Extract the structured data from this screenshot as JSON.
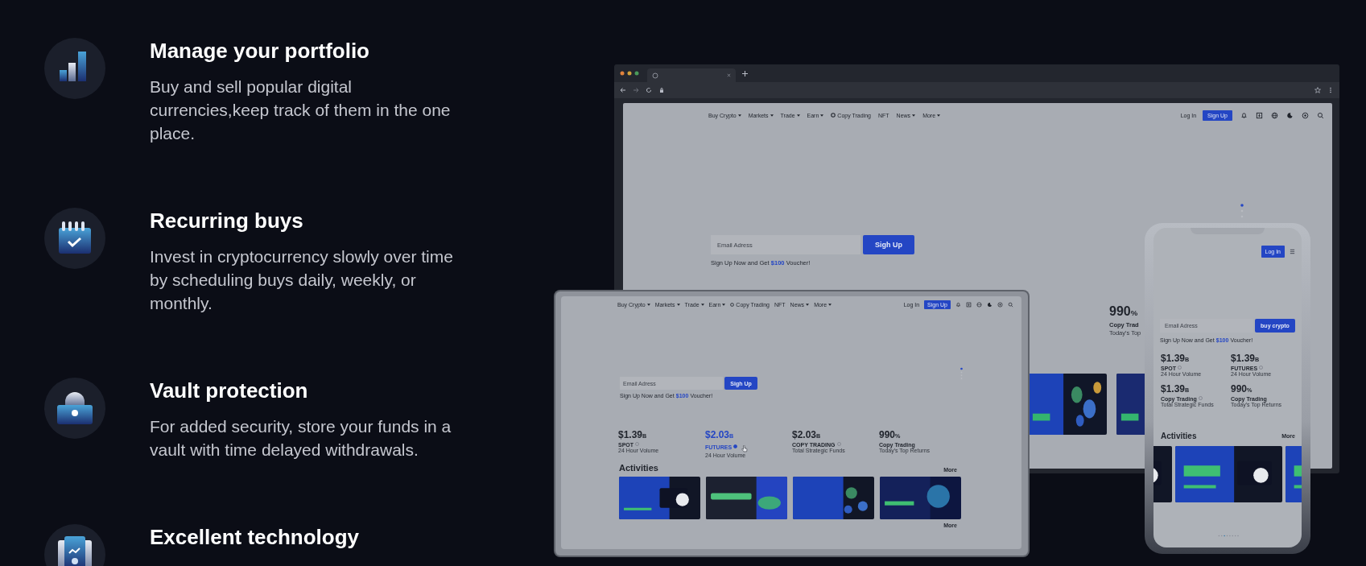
{
  "features": [
    {
      "title": "Manage your portfolio",
      "description": "Buy and sell popular digital currencies,keep track of them in the one place."
    },
    {
      "title": "Recurring buys",
      "description": "Invest in cryptocurrency slowly over time by scheduling buys daily, weekly, or monthly."
    },
    {
      "title": "Vault protection",
      "description": "For added security, store your funds in a vault with time delayed withdrawals."
    },
    {
      "title": "Excellent technology"
    }
  ],
  "browser": {
    "nav": [
      {
        "label": "Buy Crypto",
        "kind": "menu"
      },
      {
        "label": "Markets",
        "kind": "menu"
      },
      {
        "label": "Trade",
        "kind": "menu"
      },
      {
        "label": "Earn",
        "kind": "menu"
      },
      {
        "label": "Copy Trading",
        "kind": "featured"
      },
      {
        "label": "NFT",
        "kind": "link"
      },
      {
        "label": "News",
        "kind": "menu"
      },
      {
        "label": "More",
        "kind": "menu"
      }
    ],
    "login": "Log In",
    "signup": "Sign Up",
    "email_placeholder": "Email Adress",
    "hero_button": "Sigh Up",
    "voucher": {
      "before": "Sign Up Now and Get",
      "amount": "$100",
      "after": "Voucher!"
    },
    "stat": {
      "value": "990",
      "unit": "%",
      "label": "Copy Trad",
      "sub": "Today's Top"
    }
  },
  "laptop": {
    "nav": [
      {
        "label": "Buy Crypto",
        "kind": "menu"
      },
      {
        "label": "Markets",
        "kind": "menu"
      },
      {
        "label": "Trade",
        "kind": "menu"
      },
      {
        "label": "Earn",
        "kind": "menu"
      },
      {
        "label": "Copy Trading",
        "kind": "featured"
      },
      {
        "label": "NFT",
        "kind": "link"
      },
      {
        "label": "News",
        "kind": "menu"
      },
      {
        "label": "More",
        "kind": "menu"
      }
    ],
    "login": "Log In",
    "signup": "Sign Up",
    "email_placeholder": "Email Adress",
    "hero_button": "Sigh Up",
    "voucher": {
      "before": "Sign Up Now and Get",
      "amount": "$100",
      "after": "Voucher!"
    },
    "stats": [
      {
        "value": "$1.39",
        "unit": "B",
        "label": "SPOT",
        "info": true,
        "sub": "24 Hour Volume",
        "highlighted": false
      },
      {
        "value": "$2.03",
        "unit": "B",
        "label": "FUTURES",
        "info": true,
        "sub": "24 Hour Volume",
        "highlighted": true
      },
      {
        "value": "$2.03",
        "unit": "B",
        "label": "COPY TRADING",
        "info": true,
        "sub": "Total Strategic Funds",
        "highlighted": false
      },
      {
        "value": "990",
        "unit": "%",
        "label": "Copy Trading",
        "info": false,
        "sub": "Today's Top Returns",
        "highlighted": false
      }
    ],
    "activities_title": "Activities",
    "more": "More",
    "footer_more": "More"
  },
  "phone": {
    "login": "Log In",
    "email_placeholder": "Email Adress",
    "hero_button": "buy crypto",
    "voucher": {
      "before": "Sign Up Now and Get",
      "amount": "$100",
      "after": "Voucher!"
    },
    "stats": [
      {
        "value": "$1.39",
        "unit": "B",
        "label": "SPOT",
        "info": true,
        "sub": "24 Hour Volume",
        "highlighted": false
      },
      {
        "value": "$1.39",
        "unit": "B",
        "label": "FUTURES",
        "info": true,
        "sub": "24 Hour Volume",
        "highlighted": false
      },
      {
        "value": "$1.39",
        "unit": "B",
        "label": "Copy Trading",
        "info": true,
        "sub": "Total Strategic Funds",
        "highlighted": false
      },
      {
        "value": "990",
        "unit": "%",
        "label": "Copy Trading",
        "info": false,
        "sub": "Today's Top Returns",
        "highlighted": false
      }
    ],
    "activities_title": "Activities",
    "more": "More"
  }
}
